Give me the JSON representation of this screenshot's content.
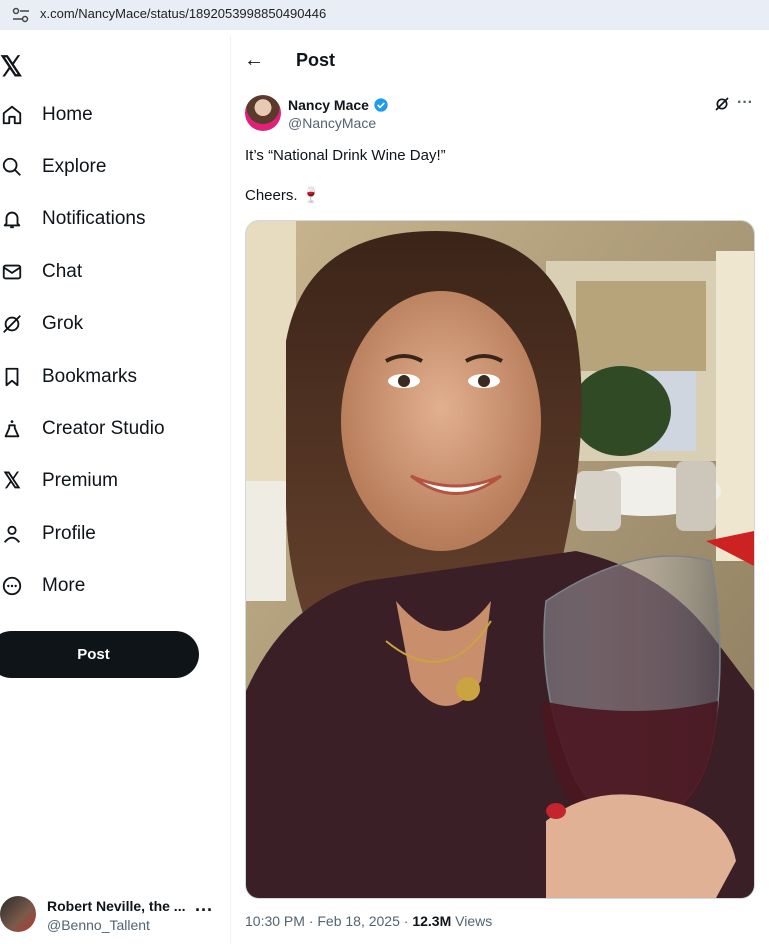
{
  "browser": {
    "url": "x.com/NancyMace/status/1892053998850490446"
  },
  "sidebar": {
    "items": [
      {
        "label": "Home",
        "icon": "home-icon"
      },
      {
        "label": "Explore",
        "icon": "search-icon"
      },
      {
        "label": "Notifications",
        "icon": "bell-icon"
      },
      {
        "label": "Chat",
        "icon": "mail-icon"
      },
      {
        "label": "Grok",
        "icon": "grok-icon"
      },
      {
        "label": "Bookmarks",
        "icon": "bookmark-icon"
      },
      {
        "label": "Creator Studio",
        "icon": "flask-icon"
      },
      {
        "label": "Premium",
        "icon": "x-icon"
      },
      {
        "label": "Profile",
        "icon": "person-icon"
      },
      {
        "label": "More",
        "icon": "more-circle-icon"
      }
    ],
    "post_label": "Post",
    "account": {
      "name": "Robert Neville, the ...",
      "handle": "@Benno_Tallent"
    }
  },
  "header": {
    "title": "Post"
  },
  "tweet": {
    "author_name": "Nancy Mace",
    "author_handle": "@NancyMace",
    "text": "It’s “National Drink Wine Day!”\n\nCheers. 🍷",
    "time": "10:30 PM · Feb 18, 2025 · ",
    "views_count": "12.3M",
    "views_label": " Views"
  },
  "colors": {
    "verified": "#1d9bf0",
    "text": "#0f1419",
    "muted": "#536471"
  }
}
